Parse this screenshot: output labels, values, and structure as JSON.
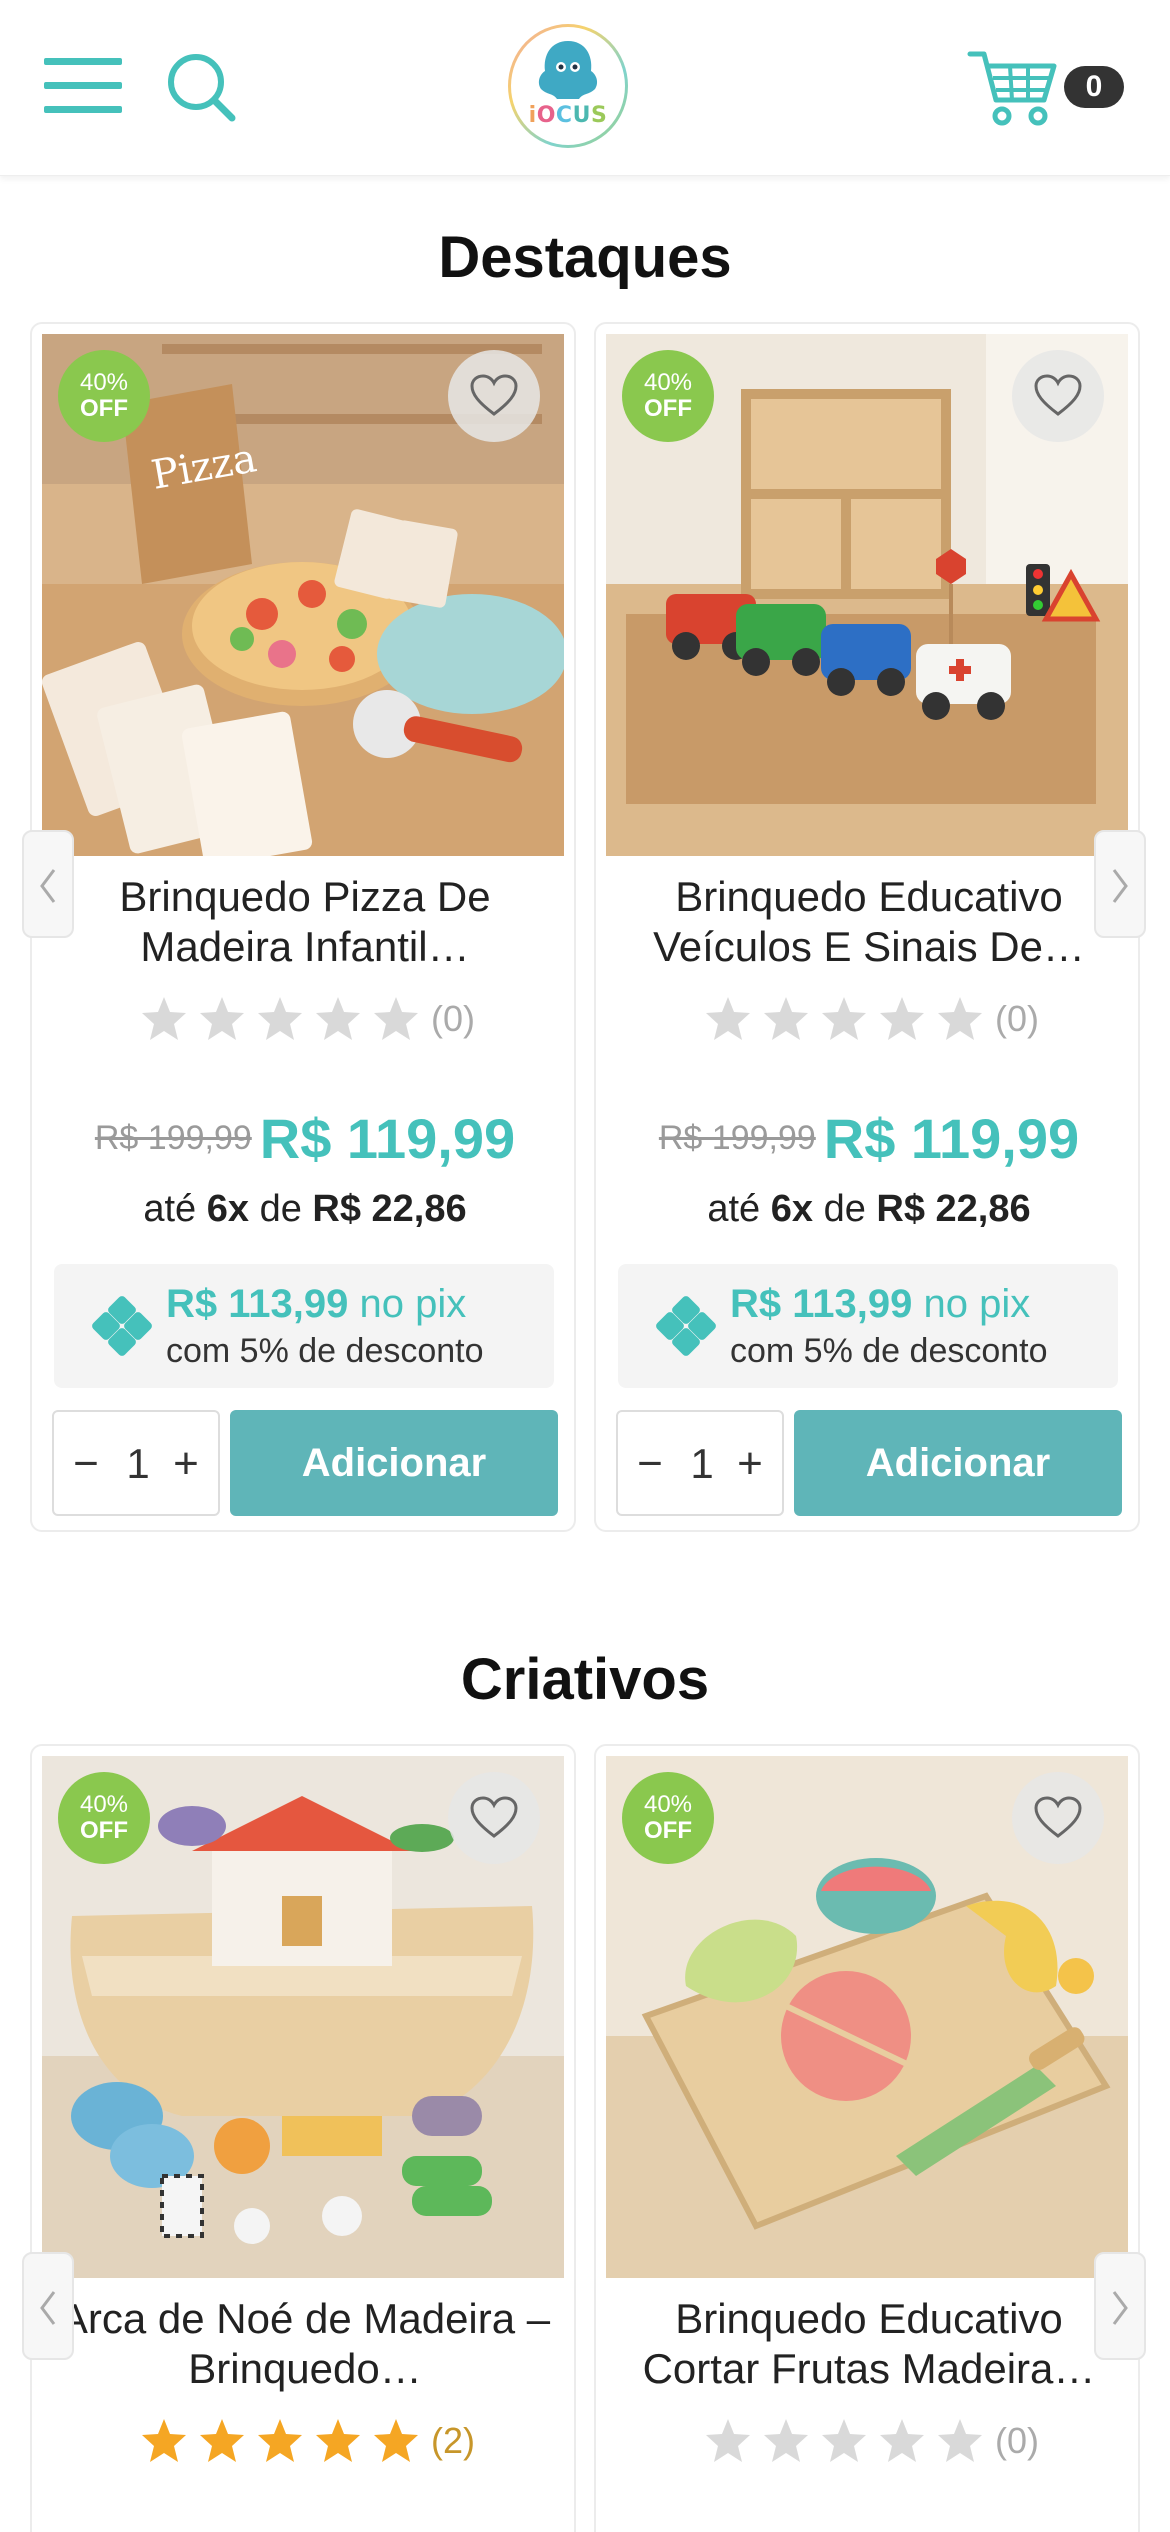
{
  "header": {
    "menu_icon": "hamburger-menu-icon",
    "search_icon": "search-icon",
    "logo_text": [
      "i",
      "O",
      "C",
      "U",
      "S"
    ],
    "cart_icon": "cart-icon",
    "cart_count": "0"
  },
  "colors": {
    "accent": "#45c1bb",
    "button": "#5fb5b8",
    "badge": "#8ac84e",
    "star_filled": "#f5a623",
    "star_empty": "#d9d9d9"
  },
  "sections": [
    {
      "title": "Destaques",
      "products": [
        {
          "badge_pct": "40%",
          "badge_off": "OFF",
          "title": "Brinquedo Pizza De Madeira Infantil…",
          "rating": 0,
          "review_count": "(0)",
          "old_price": "R$ 199,99",
          "price": "R$ 119,99",
          "installment_prefix": "até ",
          "installment_times": "6x",
          "installment_mid": " de ",
          "installment_value": "R$ 22,86",
          "pix_price": "R$ 113,99",
          "pix_label": " no pix",
          "pix_discount": "com 5% de desconto",
          "quantity": "1",
          "add_label": "Adicionar",
          "image": "pizza-toy-image"
        },
        {
          "badge_pct": "40%",
          "badge_off": "OFF",
          "title": "Brinquedo Educativo Veículos E Sinais De…",
          "rating": 0,
          "review_count": "(0)",
          "old_price": "R$ 199,99",
          "price": "R$ 119,99",
          "installment_prefix": "até ",
          "installment_times": "6x",
          "installment_mid": " de ",
          "installment_value": "R$ 22,86",
          "pix_price": "R$ 113,99",
          "pix_label": " no pix",
          "pix_discount": "com 5% de desconto",
          "quantity": "1",
          "add_label": "Adicionar",
          "image": "vehicles-signs-toy-image"
        }
      ]
    },
    {
      "title": "Criativos",
      "products": [
        {
          "badge_pct": "40%",
          "badge_off": "OFF",
          "title": "Arca de Noé de Madeira – Brinquedo…",
          "rating": 5,
          "review_count": "(2)",
          "image": "noah-ark-toy-image"
        },
        {
          "badge_pct": "40%",
          "badge_off": "OFF",
          "title": "Brinquedo Educativo Cortar Frutas Madeira…",
          "rating": 0,
          "review_count": "(0)",
          "image": "cut-fruits-toy-image"
        }
      ]
    }
  ]
}
